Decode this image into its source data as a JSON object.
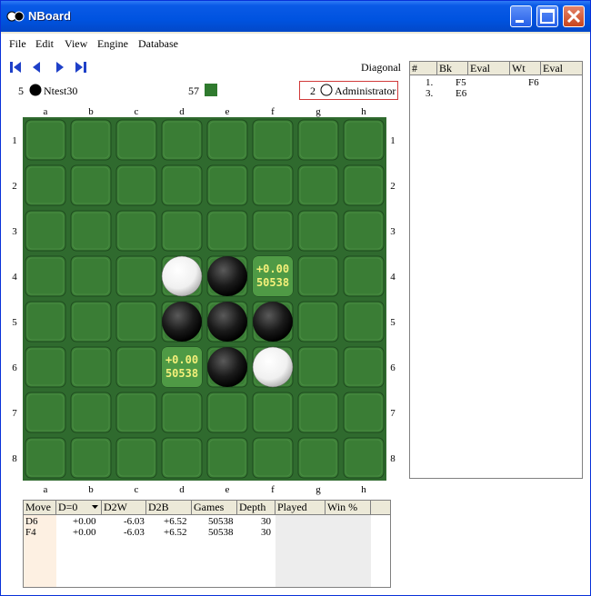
{
  "window": {
    "title": "NBoard"
  },
  "menu": [
    "File",
    "Edit",
    "View",
    "Engine",
    "Database"
  ],
  "toolbar": {
    "nav": [
      "first-icon",
      "back-icon",
      "forward-icon",
      "last-icon"
    ],
    "mode": "Diagonal"
  },
  "players": {
    "black": {
      "count": "5",
      "name": "Ntest30"
    },
    "center": {
      "count": "57"
    },
    "white": {
      "count": "2",
      "name": "Administrator"
    }
  },
  "board": {
    "columns": [
      "a",
      "b",
      "c",
      "d",
      "e",
      "f",
      "g",
      "h"
    ],
    "rows": [
      "1",
      "2",
      "3",
      "4",
      "5",
      "6",
      "7",
      "8"
    ],
    "white": [
      "d4",
      "f6"
    ],
    "black": [
      "e4",
      "d5",
      "e5",
      "f5",
      "e6"
    ],
    "hints": [
      {
        "cell": "f4",
        "eval": "+0.00",
        "games": "50538"
      },
      {
        "cell": "d6",
        "eval": "+0.00",
        "games": "50538"
      }
    ],
    "colors": {
      "board": "#2f6a2e",
      "square": "#3a7d35",
      "hint_text": "#f4f07a"
    }
  },
  "move_list": {
    "headers": [
      "#",
      "Bk",
      "Eval",
      "Wt",
      "Eval"
    ],
    "rows": [
      {
        "num": "1.",
        "bk": "F5",
        "bk_eval": "",
        "wt": "F6",
        "wt_eval": ""
      },
      {
        "num": "3.",
        "bk": "E6",
        "bk_eval": "",
        "wt": "",
        "wt_eval": ""
      }
    ]
  },
  "analysis": {
    "headers": [
      "Move",
      "D=0",
      "D2W",
      "D2B",
      "Games",
      "Depth",
      "Played",
      "Win %"
    ],
    "rows": [
      [
        "D6",
        "+0.00",
        "-6.03",
        "+6.52",
        "50538",
        "30",
        "",
        ""
      ],
      [
        "F4",
        "+0.00",
        "-6.03",
        "+6.52",
        "50538",
        "30",
        "",
        ""
      ]
    ]
  }
}
